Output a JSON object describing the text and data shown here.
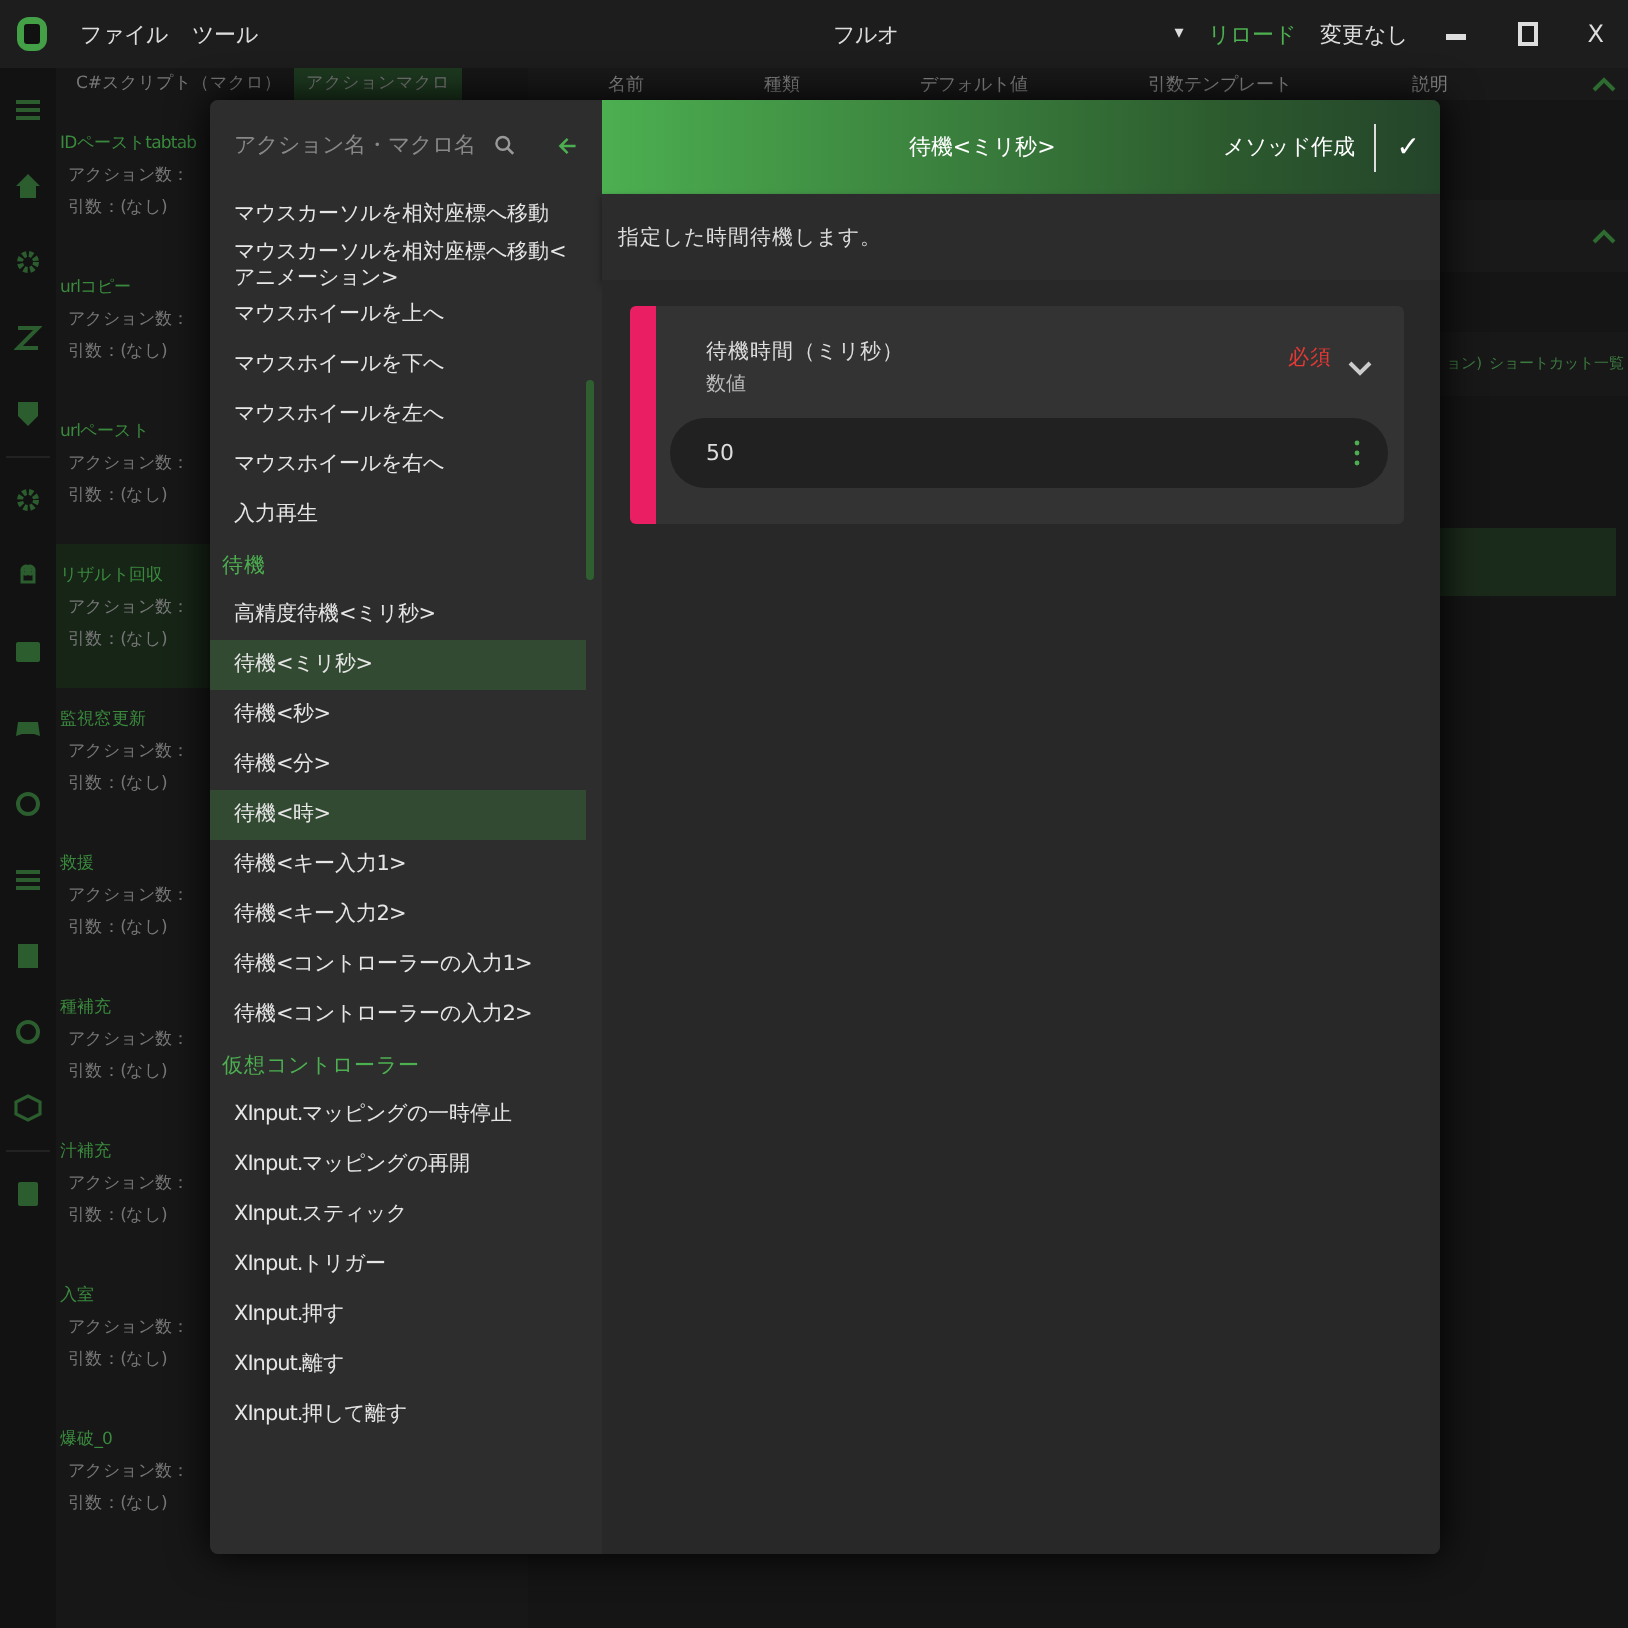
{
  "titlebar": {
    "menus": [
      "ファイル",
      "ツール"
    ],
    "title": "フルオ",
    "dropdown": "▾",
    "reload": "リロード",
    "status": "変更なし",
    "close": "X"
  },
  "macro_tabs": [
    {
      "label": "C#スクリプト（マクロ）",
      "selected": false
    },
    {
      "label": "アクションマクロ",
      "selected": true
    }
  ],
  "macros": [
    {
      "name": "IDペーストtabtab",
      "actions": "アクション数：",
      "args": "引数：(なし)",
      "selected": false
    },
    {
      "name": "urlコピー",
      "actions": "アクション数：",
      "args": "引数：(なし)",
      "selected": false
    },
    {
      "name": "urlペースト",
      "actions": "アクション数：",
      "args": "引数：(なし)",
      "selected": false
    },
    {
      "name": "リザルト回収",
      "actions": "アクション数：",
      "args": "引数：(なし)",
      "selected": true
    },
    {
      "name": "監視窓更新",
      "actions": "アクション数：",
      "args": "引数：(なし)",
      "selected": false
    },
    {
      "name": "救援",
      "actions": "アクション数：",
      "args": "引数：(なし)",
      "selected": false
    },
    {
      "name": "種補充",
      "actions": "アクション数：",
      "args": "引数：(なし)",
      "selected": false
    },
    {
      "name": "汁補充",
      "actions": "アクション数：",
      "args": "引数：(なし)",
      "selected": false
    },
    {
      "name": "入室",
      "actions": "アクション数：",
      "args": "引数：(なし)",
      "selected": false
    },
    {
      "name": "爆破_0",
      "actions": "アクション数：",
      "args": "引数：(なし)",
      "selected": false
    }
  ],
  "columns": [
    "名前",
    "種類",
    "デフォルト値",
    "引数テンプレート",
    "説明"
  ],
  "side_links": [
    "ョン)",
    "ショートカット一覧"
  ],
  "modal": {
    "search": {
      "placeholder": "アクション名・マクロ名"
    },
    "items": [
      {
        "kind": "item",
        "label": "マウスカーソルを相対座標へ移動",
        "selected": false
      },
      {
        "kind": "item",
        "label": "マウスカーソルを相対座標へ移動<アニメーション>",
        "selected": false
      },
      {
        "kind": "item",
        "label": "マウスホイールを上へ",
        "selected": false
      },
      {
        "kind": "item",
        "label": "マウスホイールを下へ",
        "selected": false
      },
      {
        "kind": "item",
        "label": "マウスホイールを左へ",
        "selected": false
      },
      {
        "kind": "item",
        "label": "マウスホイールを右へ",
        "selected": false
      },
      {
        "kind": "item",
        "label": "入力再生",
        "selected": false
      },
      {
        "kind": "header",
        "label": "待機",
        "selected": false
      },
      {
        "kind": "item",
        "label": "高精度待機<ミリ秒>",
        "selected": false
      },
      {
        "kind": "item",
        "label": "待機<ミリ秒>",
        "selected": true
      },
      {
        "kind": "item",
        "label": "待機<秒>",
        "selected": false
      },
      {
        "kind": "item",
        "label": "待機<分>",
        "selected": false
      },
      {
        "kind": "item",
        "label": "待機<時>",
        "selected": true
      },
      {
        "kind": "item",
        "label": "待機<キー入力1>",
        "selected": false
      },
      {
        "kind": "item",
        "label": "待機<キー入力2>",
        "selected": false
      },
      {
        "kind": "item",
        "label": "待機<コントローラーの入力1>",
        "selected": false
      },
      {
        "kind": "item",
        "label": "待機<コントローラーの入力2>",
        "selected": false
      },
      {
        "kind": "header",
        "label": "仮想コントローラー",
        "selected": false
      },
      {
        "kind": "item",
        "label": "XInput.マッピングの一時停止",
        "selected": false
      },
      {
        "kind": "item",
        "label": "XInput.マッピングの再開",
        "selected": false
      },
      {
        "kind": "item",
        "label": "XInput.スティック",
        "selected": false
      },
      {
        "kind": "item",
        "label": "XInput.トリガー",
        "selected": false
      },
      {
        "kind": "item",
        "label": "XInput.押す",
        "selected": false
      },
      {
        "kind": "item",
        "label": "XInput.離す",
        "selected": false
      },
      {
        "kind": "item",
        "label": "XInput.押して離す",
        "selected": false
      }
    ],
    "title": "待機<ミリ秒>",
    "create_method": "メソッド作成",
    "confirm": "✓",
    "description": "指定した時間待機します。",
    "param": {
      "name": "待機時間（ミリ秒）",
      "type": "数値",
      "required": "必須",
      "value": "50"
    }
  }
}
